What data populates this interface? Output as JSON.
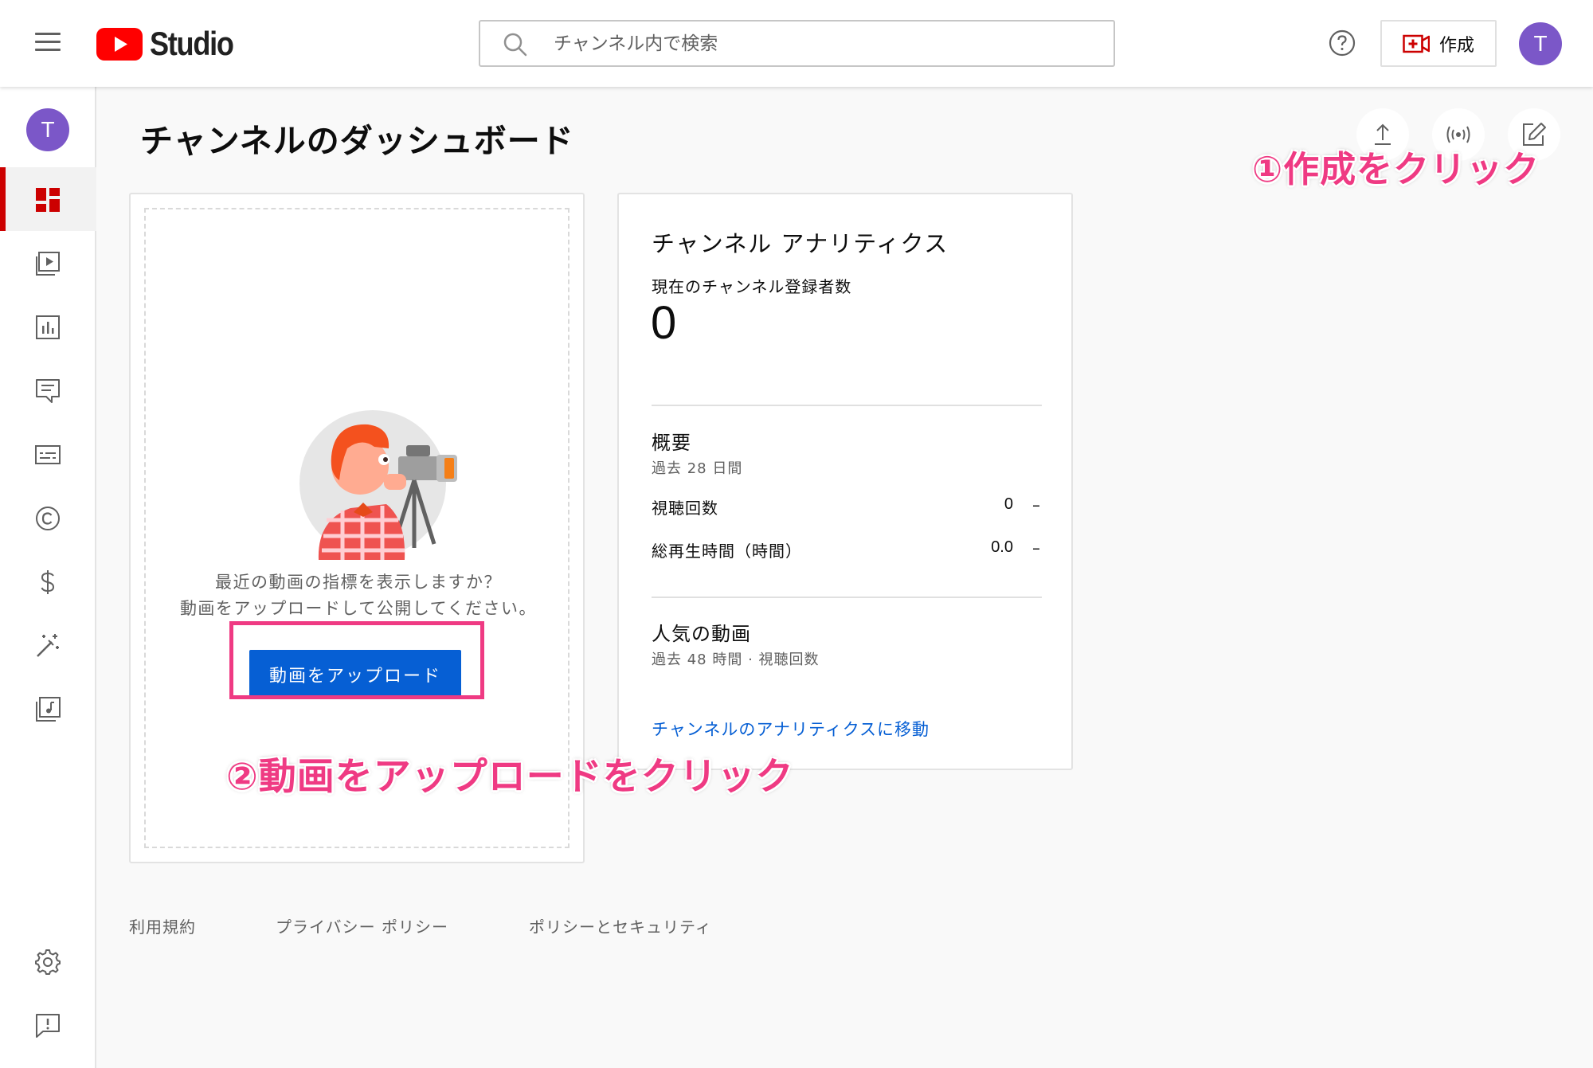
{
  "header": {
    "logo_text": "Studio",
    "search_placeholder": "チャンネル内で検索",
    "create_label": "作成",
    "avatar_initial": "T"
  },
  "sidebar": {
    "avatar_initial": "T",
    "items": [
      {
        "icon": "dashboard-icon",
        "active": true
      },
      {
        "icon": "content-icon"
      },
      {
        "icon": "analytics-icon"
      },
      {
        "icon": "comments-icon"
      },
      {
        "icon": "subtitles-icon"
      },
      {
        "icon": "copyright-icon"
      },
      {
        "icon": "monetization-icon"
      },
      {
        "icon": "customization-icon"
      },
      {
        "icon": "audio-library-icon"
      }
    ],
    "bottom_items": [
      {
        "icon": "gear-icon"
      },
      {
        "icon": "feedback-icon"
      }
    ]
  },
  "main": {
    "page_title": "チャンネルのダッシュボード",
    "actions": [
      "upload-icon",
      "live-icon",
      "edit-post-icon"
    ]
  },
  "upload_card": {
    "message_line1": "最近の動画の指標を表示しますか？",
    "message_line2": "動画をアップロードして公開してください。",
    "button_label": "動画をアップロード"
  },
  "analytics_card": {
    "title": "チャンネル アナリティクス",
    "subscribers_label": "現在のチャンネル登録者数",
    "subscribers_count": "0",
    "summary_title": "概要",
    "summary_period": "過去 28 日間",
    "rows": [
      {
        "label": "視聴回数",
        "value": "0",
        "trend": "–"
      },
      {
        "label": "総再生時間（時間）",
        "value": "0.0",
        "trend": "–"
      }
    ],
    "top_videos_title": "人気の動画",
    "top_videos_period": "過去 48 時間 · 視聴回数",
    "link_label": "チャンネルのアナリティクスに移動"
  },
  "footer": {
    "terms": "利用規約",
    "privacy": "プライバシー ポリシー",
    "policy": "ポリシーとセキュリティ"
  },
  "annotations": {
    "step1": "①作成をクリック",
    "step2": "②動画をアップロードをクリック"
  },
  "colors": {
    "accent_red": "#cc0000",
    "link_blue": "#065fd4",
    "annotation_pink": "#ef3a83",
    "avatar_purple": "#7b57c8"
  }
}
